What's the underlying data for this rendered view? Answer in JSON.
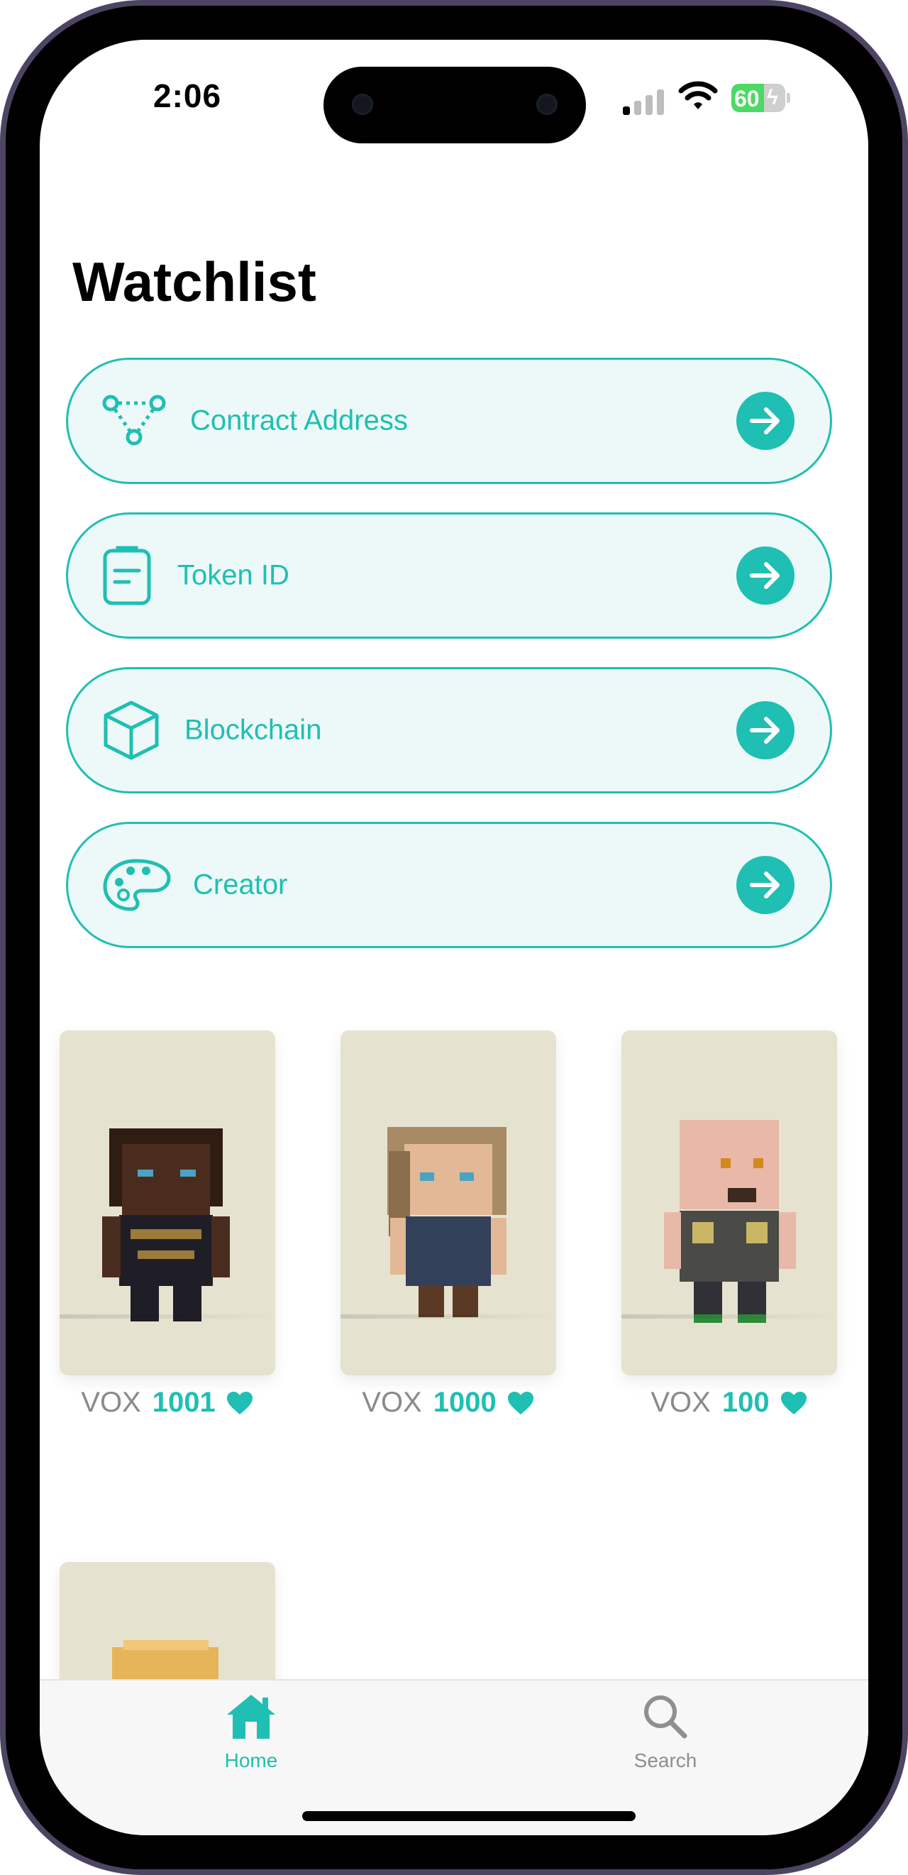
{
  "status_bar": {
    "time": "2:06",
    "battery": "60",
    "battery_level": 0.6
  },
  "page": {
    "title": "Watchlist"
  },
  "filters": [
    {
      "label": "Contract Address",
      "icon": "network-nodes-icon"
    },
    {
      "label": "Token ID",
      "icon": "clipboard-icon"
    },
    {
      "label": "Blockchain",
      "icon": "cube-icon"
    },
    {
      "label": "Creator",
      "icon": "palette-icon"
    }
  ],
  "nfts": [
    {
      "collection": "VOX",
      "token_id": "1001",
      "favorited": true
    },
    {
      "collection": "VOX",
      "token_id": "1000",
      "favorited": true
    },
    {
      "collection": "VOX",
      "token_id": "100",
      "favorited": true
    },
    {
      "collection": "",
      "token_id": "",
      "favorited": false
    }
  ],
  "tabbar": {
    "home_label": "Home",
    "search_label": "Search",
    "active": "home"
  },
  "colors": {
    "accent": "#1fbfb3",
    "card_bg": "#edf9f8",
    "thumb_bg": "#e6e2d0"
  }
}
